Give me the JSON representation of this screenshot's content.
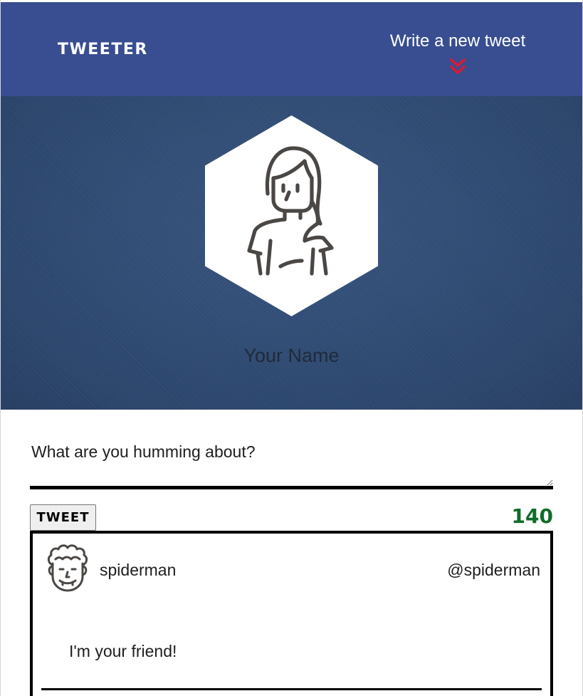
{
  "nav": {
    "brand": "TWEETER",
    "compose_link_label": "Write a new tweet"
  },
  "profile": {
    "name": "Your Name",
    "avatar_icon": "woman-avatar-icon"
  },
  "composer": {
    "placeholder": "What are you humming about?",
    "value": "",
    "submit_label": "TWEET",
    "char_counter": "140"
  },
  "tweets": [
    {
      "avatar_icon": "curly-hair-man-avatar-icon",
      "name": "spiderman",
      "handle": "@spiderman",
      "content": "I'm your friend!"
    }
  ],
  "colors": {
    "nav_background": "#394d91",
    "chevron_accent": "#e3182d",
    "banner_denim": "#2d4a72",
    "counter_green": "#116c2a",
    "text_dark": "#1e1e1e"
  }
}
